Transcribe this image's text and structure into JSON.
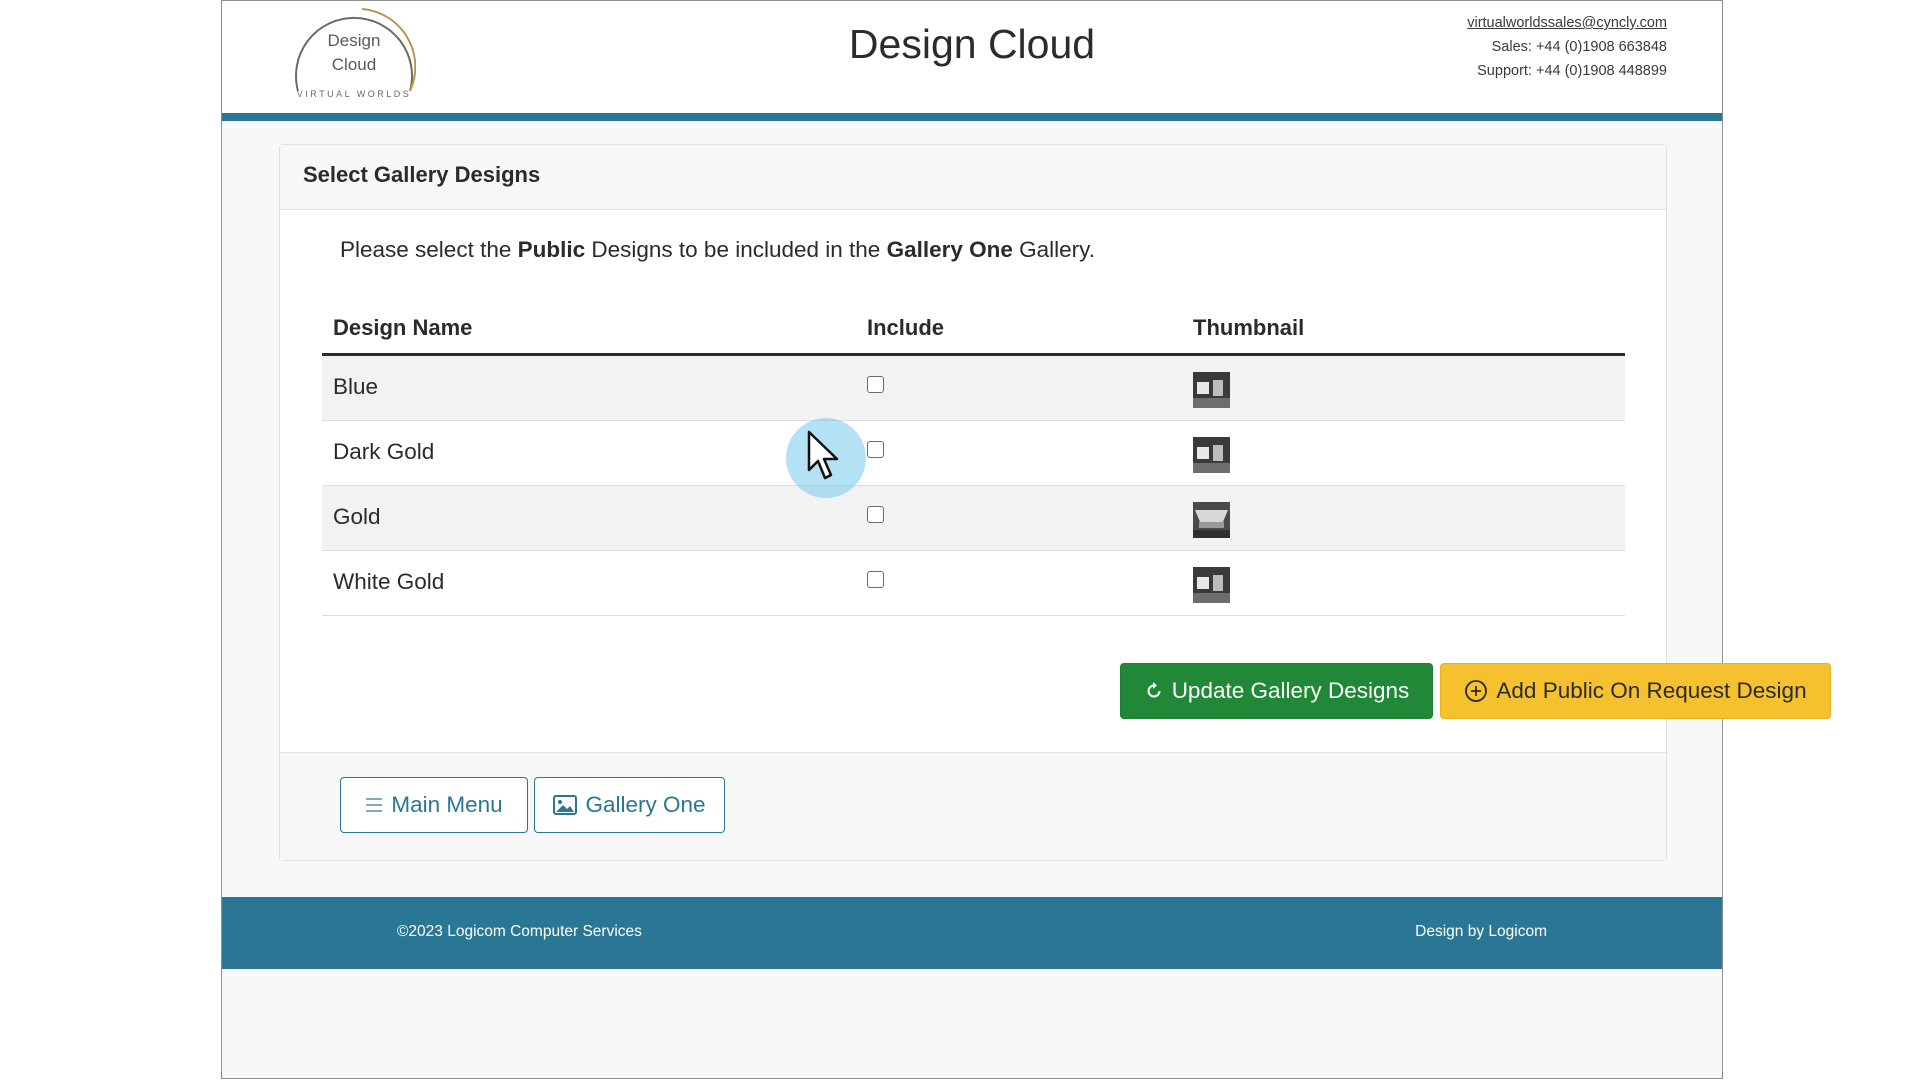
{
  "header": {
    "logo": {
      "line1": "Design",
      "line2": "Cloud",
      "tagline": "VIRTUAL WORLDS"
    },
    "title": "Design Cloud",
    "contact": {
      "email": "virtualworldssales@cyncly.com",
      "sales": "Sales: +44 (0)1908 663848",
      "support": "Support: +44 (0)1908 448899"
    }
  },
  "card": {
    "title": "Select Gallery Designs",
    "intro": {
      "part1": "Please select the ",
      "bold1": "Public",
      "part2": " Designs to be included in the ",
      "bold2": "Gallery One",
      "part3": " Gallery."
    },
    "table": {
      "columns": [
        "Design Name",
        "Include",
        "Thumbnail"
      ],
      "rows": [
        {
          "name": "Blue",
          "include": false,
          "thumbnail_icon": "design-thumbnail"
        },
        {
          "name": "Dark Gold",
          "include": false,
          "thumbnail_icon": "design-thumbnail"
        },
        {
          "name": "Gold",
          "include": false,
          "thumbnail_icon": "design-thumbnail"
        },
        {
          "name": "White Gold",
          "include": false,
          "thumbnail_icon": "design-thumbnail"
        }
      ]
    },
    "actions": {
      "update_label": "Update Gallery Designs",
      "update_icon": "refresh-icon",
      "add_label": "Add Public On Request Design",
      "add_icon": "plus-circle-icon"
    },
    "nav": {
      "main_menu_label": "Main Menu",
      "main_menu_icon": "menu-icon",
      "gallery_label": "Gallery One",
      "gallery_icon": "image-icon"
    }
  },
  "footer": {
    "copyright": "©2023 Logicom Computer Services",
    "credit": "Design by Logicom"
  },
  "colors": {
    "brand": "#2a7795",
    "success": "#218838",
    "warning": "#f5c12e"
  }
}
